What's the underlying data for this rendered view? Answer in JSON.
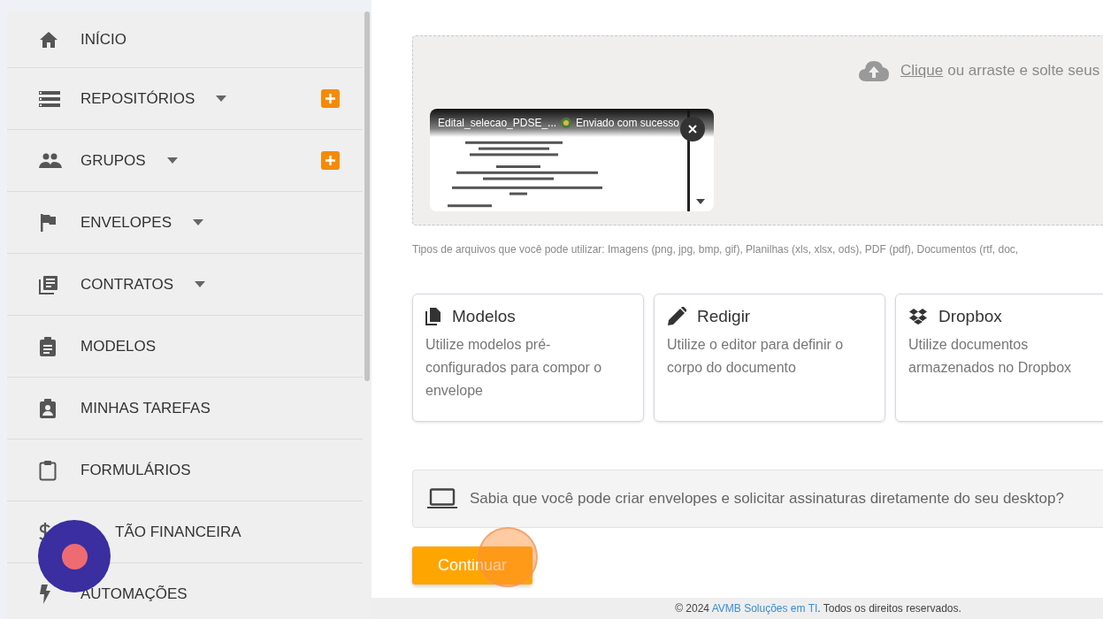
{
  "sidebar": {
    "items": [
      {
        "label": "INÍCIO",
        "kind": "home",
        "expandable": false,
        "addable": false
      },
      {
        "label": "REPOSITÓRIOS",
        "kind": "list",
        "expandable": true,
        "addable": true
      },
      {
        "label": "GRUPOS",
        "kind": "people",
        "expandable": true,
        "addable": true
      },
      {
        "label": "ENVELOPES",
        "kind": "flag",
        "expandable": true,
        "addable": false
      },
      {
        "label": "CONTRATOS",
        "kind": "docs",
        "expandable": true,
        "addable": false
      },
      {
        "label": "MODELOS",
        "kind": "clipboard-list",
        "expandable": false,
        "addable": false
      },
      {
        "label": "MINHAS TAREFAS",
        "kind": "clipboard-person",
        "expandable": false,
        "addable": false
      },
      {
        "label": "FORMULÁRIOS",
        "kind": "clipboard",
        "expandable": false,
        "addable": false
      },
      {
        "label": "TÃO FINANCEIRA",
        "kind": "dollar",
        "expandable": false,
        "addable": false
      },
      {
        "label": "AUTOMAÇÕES",
        "kind": "bolt",
        "expandable": false,
        "addable": false
      }
    ]
  },
  "upload": {
    "link": "Clique",
    "text": "ou arraste e solte seus",
    "file": {
      "name": "Edital_selecao_PDSE_...",
      "status": "Enviado com sucesso"
    },
    "hint": "Tipos de arquivos que você pode utilizar: Imagens (png, jpg, bmp, gif), Planilhas (xls, xlsx, ods), PDF (pdf), Documentos (rtf, doc,"
  },
  "options": [
    {
      "kind": "copy",
      "title": "Modelos",
      "description": "Utilize modelos pré-configurados para compor o envelope"
    },
    {
      "kind": "pencil",
      "title": "Redigir",
      "description": "Utilize o editor para definir o corpo do documento"
    },
    {
      "kind": "dropbox",
      "title": "Dropbox",
      "description": "Utilize documentos armazenados no Dropbox"
    }
  ],
  "desktop_tip": "Sabia que você pode criar envelopes e solicitar assinaturas diretamente do seu desktop?",
  "continue_button": "Continuar",
  "footer": {
    "prefix": "© 2024",
    "link": "AVMB Soluções em TI",
    "suffix": ". Todos os direitos reservados."
  }
}
